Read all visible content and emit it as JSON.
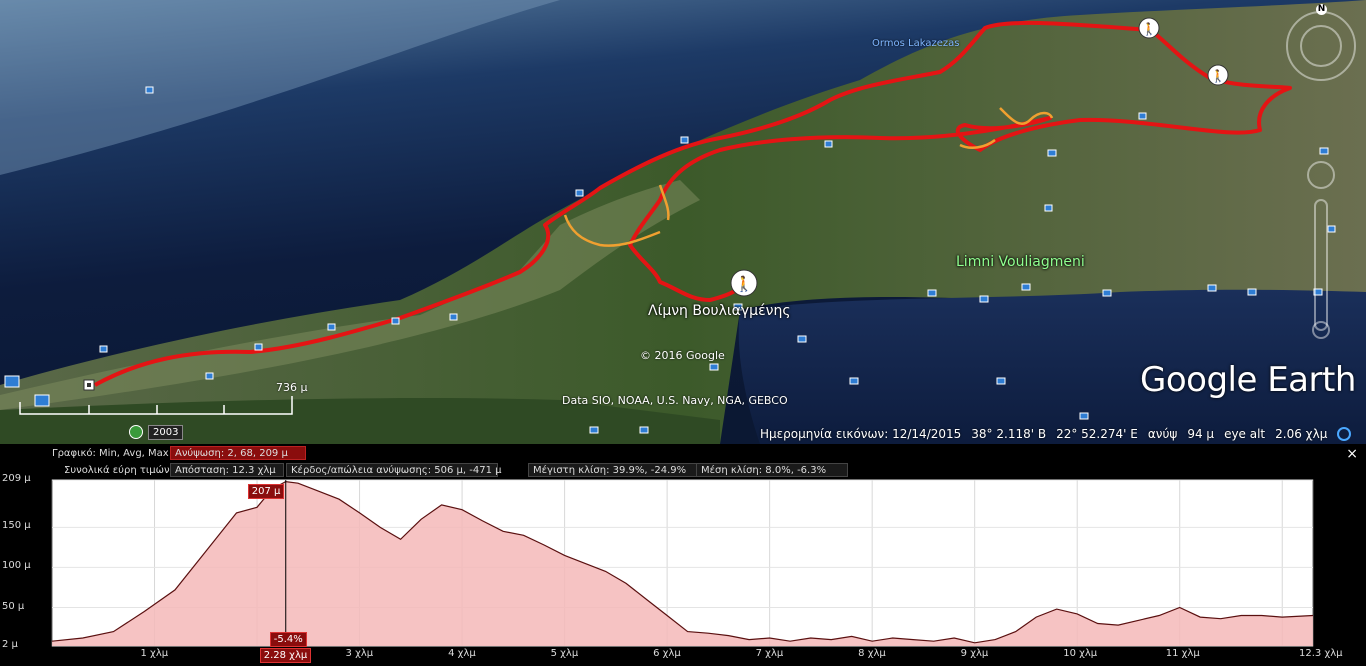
{
  "map": {
    "labels": {
      "ormos": "Ormos Lakazezas",
      "limni_en": "Limni Vouliagmeni",
      "limni_gr": "Λίμνη Βουλιαγμένης",
      "copyright": "© 2016 Google",
      "data_credit": "Data SIO, NOAA, U.S. Navy, NGA, GEBCO"
    },
    "logo": "Google Earth",
    "north": "N",
    "scale_label": "736 μ",
    "year": "2003",
    "colors": {
      "track": "#e41414",
      "track_alt": "#f0a030",
      "water_deep": "#0e1c3c",
      "land": "#3c5a2a"
    }
  },
  "statusbar": {
    "image_date": "Ημερομηνία εικόνων: 12/14/2015",
    "lat": "38° 2.118' Β",
    "lon": "22° 52.274' Ε",
    "elev_label": "ανύψ",
    "elev": "94 μ",
    "eye_label": "eye alt",
    "eye": "2.06 χλμ"
  },
  "profile": {
    "row1_label": "Γραφικό: Min, Avg, Max",
    "row1_value": "Ανύψωση: 2, 68, 209 μ",
    "row2_label": "Συνολικά εύρη τιμών:",
    "distance": "Απόσταση: 12.3 χλμ",
    "gain_loss": "Κέρδος/απώλεια ανύψωσης: 506 μ, -471 μ",
    "max_slope": "Μέγιστη κλίση: 39.9%, -24.9%",
    "avg_slope": "Μέση κλίση: 8.0%, -6.3%",
    "close": "×",
    "marker_elev": "207 μ",
    "marker_slope": "-5.4%",
    "marker_dist": "2.28 χλμ"
  },
  "chart_data": {
    "type": "area",
    "ylabel": "",
    "xlabel": "",
    "y_ticks": [
      "209 μ",
      "150 μ",
      "100 μ",
      "50 μ",
      "2 μ"
    ],
    "x_ticks": [
      "1 χλμ",
      "2.28 χλμ",
      "3 χλμ",
      "4 χλμ",
      "5 χλμ",
      "6 χλμ",
      "7 χλμ",
      "8 χλμ",
      "9 χλμ",
      "10 χλμ",
      "11 χλμ",
      "12.3 χλμ"
    ],
    "ylim": [
      2,
      209
    ],
    "xlim": [
      0,
      12.3
    ],
    "grid": true,
    "x": [
      0,
      0.3,
      0.6,
      0.9,
      1.2,
      1.5,
      1.8,
      2.0,
      2.15,
      2.28,
      2.4,
      2.6,
      2.8,
      3.0,
      3.2,
      3.4,
      3.6,
      3.8,
      4.0,
      4.2,
      4.4,
      4.6,
      4.8,
      5.0,
      5.2,
      5.4,
      5.6,
      5.8,
      6.0,
      6.2,
      6.4,
      6.6,
      6.8,
      7.0,
      7.2,
      7.4,
      7.6,
      7.8,
      8.0,
      8.2,
      8.4,
      8.6,
      8.8,
      9.0,
      9.2,
      9.4,
      9.6,
      9.8,
      10.0,
      10.2,
      10.4,
      10.6,
      10.8,
      11.0,
      11.2,
      11.4,
      11.6,
      11.8,
      12.0,
      12.3
    ],
    "y": [
      8,
      12,
      20,
      45,
      72,
      120,
      168,
      175,
      198,
      207,
      205,
      195,
      185,
      168,
      150,
      135,
      160,
      178,
      172,
      158,
      145,
      140,
      128,
      115,
      105,
      95,
      80,
      60,
      40,
      20,
      18,
      15,
      10,
      12,
      8,
      12,
      10,
      14,
      8,
      12,
      10,
      8,
      12,
      6,
      10,
      20,
      38,
      48,
      42,
      30,
      28,
      34,
      40,
      50,
      38,
      36,
      40,
      40,
      38,
      40
    ]
  }
}
